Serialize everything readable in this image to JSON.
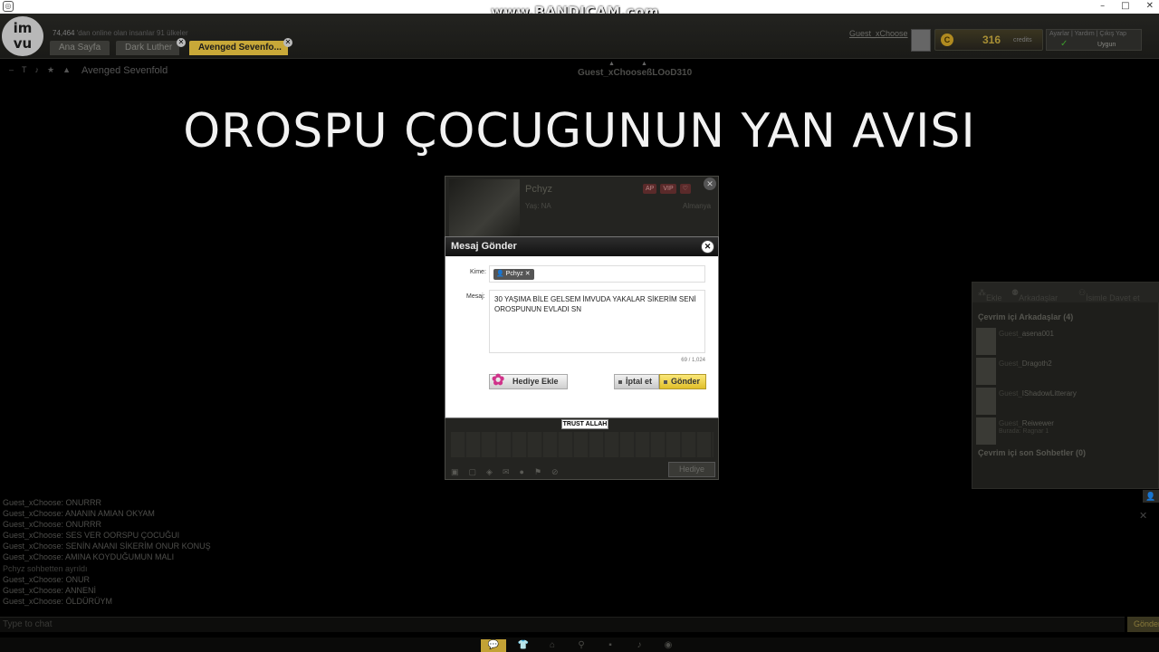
{
  "watermark": "www.BANDICAM.com",
  "window": {
    "app_icon": "imvu-icon",
    "controls": [
      "–",
      "□",
      "✕"
    ]
  },
  "header": {
    "logo_text_top": "im",
    "logo_text_bottom": "vu",
    "online_count": "74,464",
    "online_text": "'dan online olan insanlar 91 ülkeler",
    "tabs": [
      {
        "label": "Ana Sayfa"
      },
      {
        "label": "Dark Luther"
      },
      {
        "label": "Avenged Sevenfo..."
      }
    ],
    "guest_name": "Guest_xChoose",
    "credits": {
      "amount": "316",
      "label": "credits"
    },
    "account_links": "Ayarlar | Yardım | Çıkış Yap",
    "status": "Uygun"
  },
  "room": {
    "name": "Avenged Sevenfold",
    "users": [
      "Guest_xChoose",
      "ßLOoD310"
    ]
  },
  "caption": "OROSPU ÇOCUGUNUN YAN AVISI",
  "profile": {
    "name": "Pchyz",
    "age": "Yaş: NA",
    "country": "Almanya",
    "badges": [
      "AP",
      "VIP",
      "♡"
    ],
    "band_label": "TRUST ALLAH",
    "gift_label": "Hediye"
  },
  "dialog": {
    "title": "Mesaj Gönder",
    "to_label": "Kime:",
    "to_recipient": "Pchyz",
    "message_label": "Mesaj:",
    "message": "30 YAŞIMA BİLE GELSEM İMVUDA YAKALAR SİKERİM SENİ OROSPUNUN EVLADI SN",
    "char_count": "69 / 1,024",
    "gift_button": "Hediye Ekle",
    "cancel_button": "İptal et",
    "send_button": "Gönder"
  },
  "friends_panel": {
    "toolbar": [
      "Ekle",
      "Arkadaşlar",
      "İsimle Davet et"
    ],
    "online_header": "Çevrim içi Arkadaşlar (4)",
    "friends": [
      {
        "prefix": "Guest_",
        "name": "asena001",
        "sub": ""
      },
      {
        "prefix": "Guest_",
        "name": "Dragoth2",
        "sub": ""
      },
      {
        "prefix": "Guest_",
        "name": "IShadowLitterary",
        "sub": ""
      },
      {
        "prefix": "Guest_",
        "name": "Reiwewer",
        "sub": "Burada: Ragnar 1"
      }
    ],
    "recent_header": "Çevrim içi son Sohbetler (0)"
  },
  "chat": {
    "lines": [
      {
        "who": "Guest_xChoose",
        "text": ": ONURRR"
      },
      {
        "who": "Guest_xChoose",
        "text": ": ANANIN AMIAN OKYAM"
      },
      {
        "who": "Guest_xChoose",
        "text": ": ONURRR"
      },
      {
        "who": "Guest_xChoose",
        "text": ": SES VER OORSPU ÇOCUĞUI"
      },
      {
        "who": "Guest_xChoose",
        "text": ": SENİN ANANI SİKERİM ONUR KONUŞ"
      },
      {
        "who": "Guest_xChoose",
        "text": ": AMINA KOYDUĞUMUN MALI"
      },
      {
        "who": "",
        "text": "Pchyz sohbetten ayrıldı"
      },
      {
        "who": "Guest_xChoose",
        "text": ": ONUR"
      },
      {
        "who": "Guest_xChoose",
        "text": ": ANNENİ"
      },
      {
        "who": "Guest_xChoose",
        "text": ": ÖLDÜRÜYM"
      }
    ],
    "input_placeholder": "Type to chat",
    "send_label": "Gönder"
  },
  "bottom_toolbar": {
    "icons": [
      "chat-bubble-icon",
      "shirt-icon",
      "hanger-icon",
      "pose-icon",
      "furniture-icon",
      "music-icon",
      "camera-icon"
    ]
  },
  "colors": {
    "accent": "#c3a235",
    "send_button": "#e0bf2a"
  }
}
